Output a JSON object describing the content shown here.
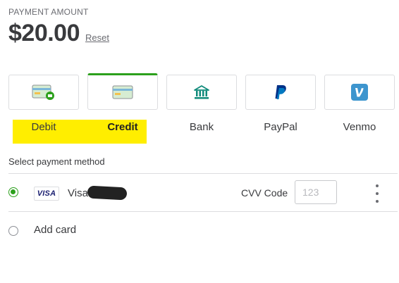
{
  "payment": {
    "amount_label": "PAYMENT AMOUNT",
    "amount": "$20.00",
    "reset_label": "Reset"
  },
  "methods": [
    {
      "label": "Debit",
      "icon": "debit-card-icon",
      "selected": false
    },
    {
      "label": "Credit",
      "icon": "credit-card-icon",
      "selected": true
    },
    {
      "label": "Bank",
      "icon": "bank-icon",
      "selected": false
    },
    {
      "label": "PayPal",
      "icon": "paypal-icon",
      "selected": false
    },
    {
      "label": "Venmo",
      "icon": "venmo-icon",
      "selected": false
    }
  ],
  "select_method_label": "Select payment method",
  "saved_card": {
    "brand_badge": "VISA",
    "name": "Visa",
    "selected": true,
    "cvv_label": "CVV Code",
    "cvv_placeholder": "123"
  },
  "add_card_label": "Add card",
  "colors": {
    "accent_green": "#2ca01c",
    "highlight_yellow": "#ffee00",
    "paypal_blue": "#003087",
    "venmo_blue": "#3d95ce",
    "bank_teal": "#0f8a7a"
  }
}
